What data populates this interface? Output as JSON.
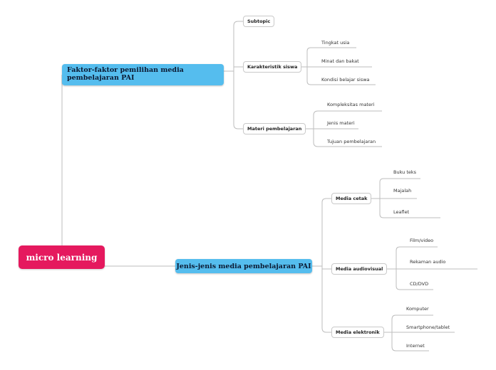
{
  "root": {
    "label": "micro learning",
    "color": "#e5195e"
  },
  "branches": [
    {
      "label": "Faktor-faktor pemilihan media pembelajaran PAI",
      "children": [
        {
          "label": "Subtopic",
          "children": []
        },
        {
          "label": "Karakteristik siswa",
          "children": [
            "Tingkat usia",
            "Minat dan bakat",
            "Kondisi belajar siswa"
          ]
        },
        {
          "label": "Materi pembelajaran",
          "children": [
            "Kompleksitas materi",
            "Jenis materi",
            "Tujuan pembelajaran"
          ]
        }
      ]
    },
    {
      "label": "Jenis-jenis media pembelajaran PAI",
      "children": [
        {
          "label": "Media cetak",
          "children": [
            "Buku teks",
            "Majalah",
            "Leaflet"
          ]
        },
        {
          "label": "Media audiovisual",
          "children": [
            "Film/video",
            "Rekaman audio",
            "CD/DVD"
          ]
        },
        {
          "label": "Media elektronik",
          "children": [
            "Komputer",
            "Smartphone/tablet",
            "Internet"
          ]
        }
      ]
    }
  ],
  "colors": {
    "main_topic": "#55bdee",
    "line": "#bdbdbd"
  }
}
